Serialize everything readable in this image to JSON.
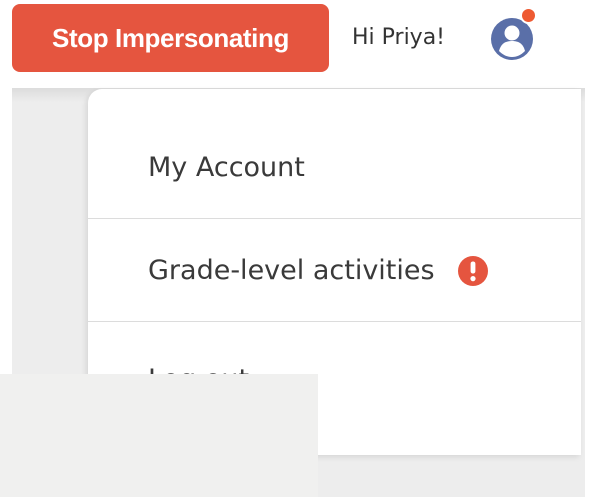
{
  "header": {
    "stop_impersonating_label": "Stop Impersonating",
    "greeting": "Hi Priya!",
    "avatar_icon": "user-circle-icon",
    "notification_dot_color": "#ee5a32"
  },
  "dropdown": {
    "items": [
      {
        "label": "My Account"
      },
      {
        "label": "Grade-level activities",
        "badge_icon": "alert-exclamation-icon",
        "badge_color": "#e5553f"
      },
      {
        "label": "Log out"
      }
    ]
  },
  "colors": {
    "accent": "#e5553f",
    "avatar": "#5a6fa8",
    "text": "#3a3a3a"
  }
}
